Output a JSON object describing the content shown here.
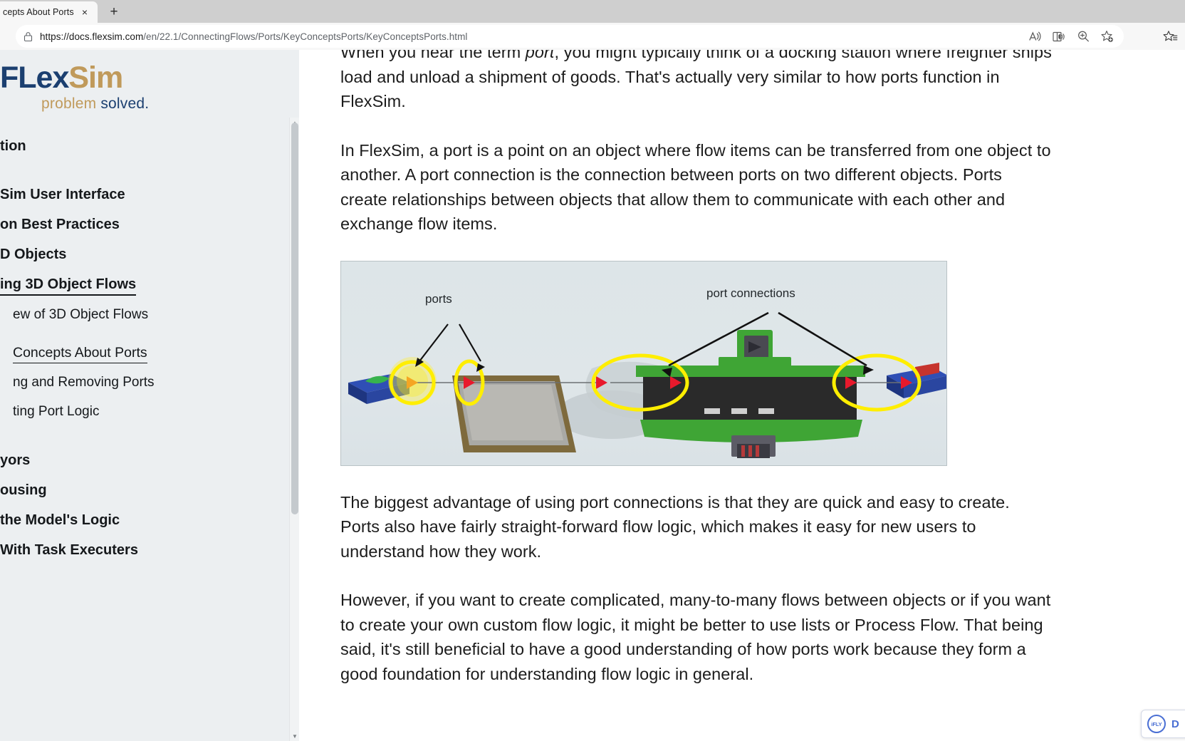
{
  "browser": {
    "tab": {
      "title": "cepts About Ports",
      "close_label": "×"
    },
    "new_tab_label": "+",
    "address": {
      "scheme_host": "https://docs.flexsim.com",
      "path": "/en/22.1/ConnectingFlows/Ports/KeyConceptsPorts/KeyConceptsPorts.html",
      "full": "https://docs.flexsim.com/en/22.1/ConnectingFlows/Ports/KeyConceptsPorts/KeyConceptsPorts.html"
    },
    "omnibox_actions": [
      {
        "name": "read-aloud-icon",
        "label": "Read aloud"
      },
      {
        "name": "immersive-reader-icon",
        "label": "Immersive Reader"
      },
      {
        "name": "zoom-icon",
        "label": "Zoom"
      },
      {
        "name": "add-favorite-icon",
        "label": "Add this page to favorites"
      }
    ],
    "chrome_actions": [
      {
        "name": "favorites-icon",
        "label": "Favorites"
      }
    ]
  },
  "sidebar": {
    "logo": {
      "flex": "FLex",
      "sim": "Sim",
      "tag_1": "problem ",
      "tag_2": "solved."
    },
    "items": [
      {
        "label": "tion",
        "level": 0,
        "state": "normal"
      },
      {
        "label": "Sim User Interface",
        "level": 0,
        "state": "normal"
      },
      {
        "label": "on Best Practices",
        "level": 0,
        "state": "normal"
      },
      {
        "label": "D Objects",
        "level": 0,
        "state": "normal"
      },
      {
        "label": "ing 3D Object Flows",
        "level": 0,
        "state": "active"
      },
      {
        "label": "ew of 3D Object Flows",
        "level": 1,
        "state": "normal"
      },
      {
        "label": "Concepts About Ports",
        "level": 1,
        "state": "active-sub"
      },
      {
        "label": "ng and Removing Ports",
        "level": 1,
        "state": "normal"
      },
      {
        "label": "ting Port Logic",
        "level": 1,
        "state": "normal"
      },
      {
        "label": "yors",
        "level": 0,
        "state": "normal"
      },
      {
        "label": "ousing",
        "level": 0,
        "state": "normal"
      },
      {
        "label": "the Model's Logic",
        "level": 0,
        "state": "normal"
      },
      {
        "label": "With Task Executers",
        "level": 0,
        "state": "normal"
      }
    ]
  },
  "main": {
    "paragraph_1": "When you hear the term port, you might typically think of a docking station where freighter ships load and unload a shipment of goods. That's actually very similar to how ports function in FlexSim.",
    "paragraph_1_pre": "When you hear the term ",
    "paragraph_1_em": "port",
    "paragraph_1_post": ", you might typically think of a docking station where freighter ships load and unload a shipment of goods. That's actually very similar to how ports function in FlexSim.",
    "paragraph_2": "In FlexSim, a port is a point on an object where flow items can be transferred from one object to another. A port connection is the connection between ports on two different objects. Ports create relationships between objects that allow them to communicate with each other and exchange flow items.",
    "paragraph_3": "The biggest advantage of using port connections is that they are quick and easy to create. Ports also have fairly straight-forward flow logic, which makes it easy for new users to understand how they work.",
    "paragraph_4": "However, if you want to create complicated, many-to-many flows between objects or if you want to create your own custom flow logic, it might be better to use lists or Process Flow. That being said, it's still beneficial to have a good understanding of how ports work because they form a good foundation for understanding flow logic in general.",
    "figure": {
      "label_ports": "ports",
      "label_port_connections": "port connections",
      "highlight_color": "#ffee00",
      "port_marker_color": "#e8192c",
      "source_port_color": "#f5a623",
      "conveyor_color": "#3fa535",
      "background_color": "#dde5e8"
    }
  },
  "widget": {
    "ifly_badge": "iFLY",
    "ifly_text": "D"
  }
}
